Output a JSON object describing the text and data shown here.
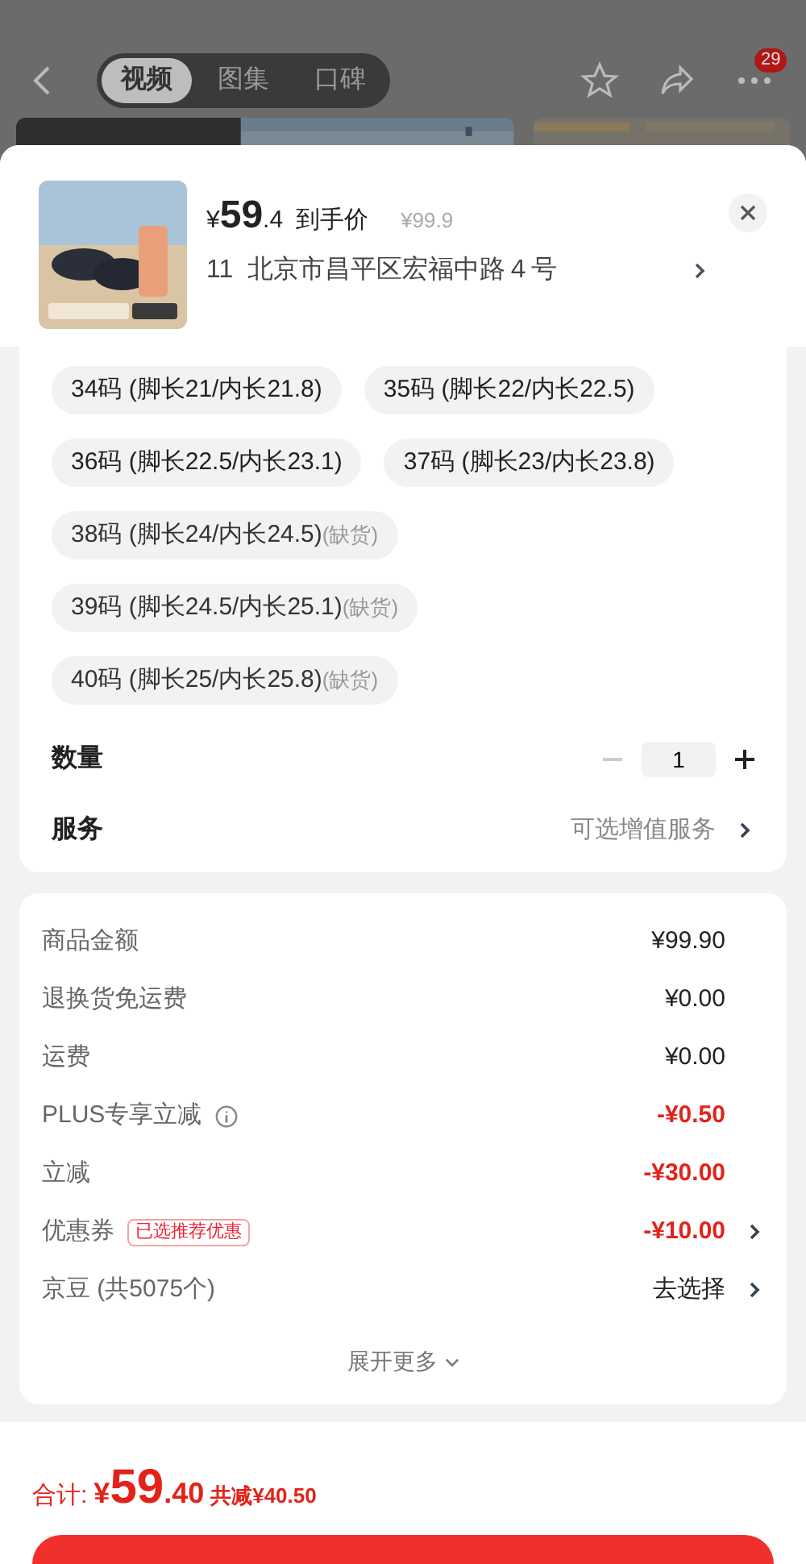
{
  "nav": {
    "tabs": [
      {
        "label": "视频",
        "selected": true
      },
      {
        "label": "图集",
        "selected": false
      },
      {
        "label": "口碑",
        "selected": false
      }
    ],
    "more_badge": "29"
  },
  "product": {
    "currency": "¥",
    "price_int": "59",
    "price_dec": ".4",
    "price_label": "到手价",
    "original_price": "¥99.9",
    "address": "11  北京市昌平区宏福中路４号"
  },
  "sizes": [
    {
      "label": "34码 (脚长21/内长21.8)",
      "out_of_stock": false
    },
    {
      "label": "35码 (脚长22/内长22.5)",
      "out_of_stock": false
    },
    {
      "label": "36码 (脚长22.5/内长23.1)",
      "out_of_stock": false
    },
    {
      "label": "37码 (脚长23/内长23.8)",
      "out_of_stock": false
    },
    {
      "label": "38码 (脚长24/内长24.5)",
      "out_of_stock": true,
      "note": "(缺货)"
    },
    {
      "label": "39码 (脚长24.5/内长25.1)",
      "out_of_stock": true,
      "note": "(缺货)"
    },
    {
      "label": "40码 (脚长25/内长25.8)",
      "out_of_stock": true,
      "note": "(缺货)"
    }
  ],
  "quantity": {
    "label": "数量",
    "value": "1",
    "minus_disabled": true
  },
  "service": {
    "label": "服务",
    "value": "可选增值服务"
  },
  "fees": [
    {
      "label": "商品金额",
      "value": "¥99.90",
      "kind": "amount",
      "arrow": false
    },
    {
      "label": "退换货免运费",
      "value": "¥0.00",
      "kind": "amount",
      "arrow": false
    },
    {
      "label": "运费",
      "value": "¥0.00",
      "kind": "amount",
      "arrow": false
    },
    {
      "label": "PLUS专享立减",
      "value": "-¥0.50",
      "kind": "discount",
      "info": true,
      "arrow": false
    },
    {
      "label": "立减",
      "value": "-¥30.00",
      "kind": "discount",
      "arrow": false
    },
    {
      "label": "优惠券",
      "tag": "已选推荐优惠",
      "value": "-¥10.00",
      "kind": "discount",
      "arrow": true
    },
    {
      "label": "京豆 (共5075个)",
      "value": "去选择",
      "kind": "amount",
      "arrow": true
    }
  ],
  "expand_more": "展开更多",
  "footer": {
    "total_label": "合计:",
    "currency": "¥",
    "total_int": "59",
    "total_dec": ".40",
    "saved": "共减¥40.50"
  }
}
